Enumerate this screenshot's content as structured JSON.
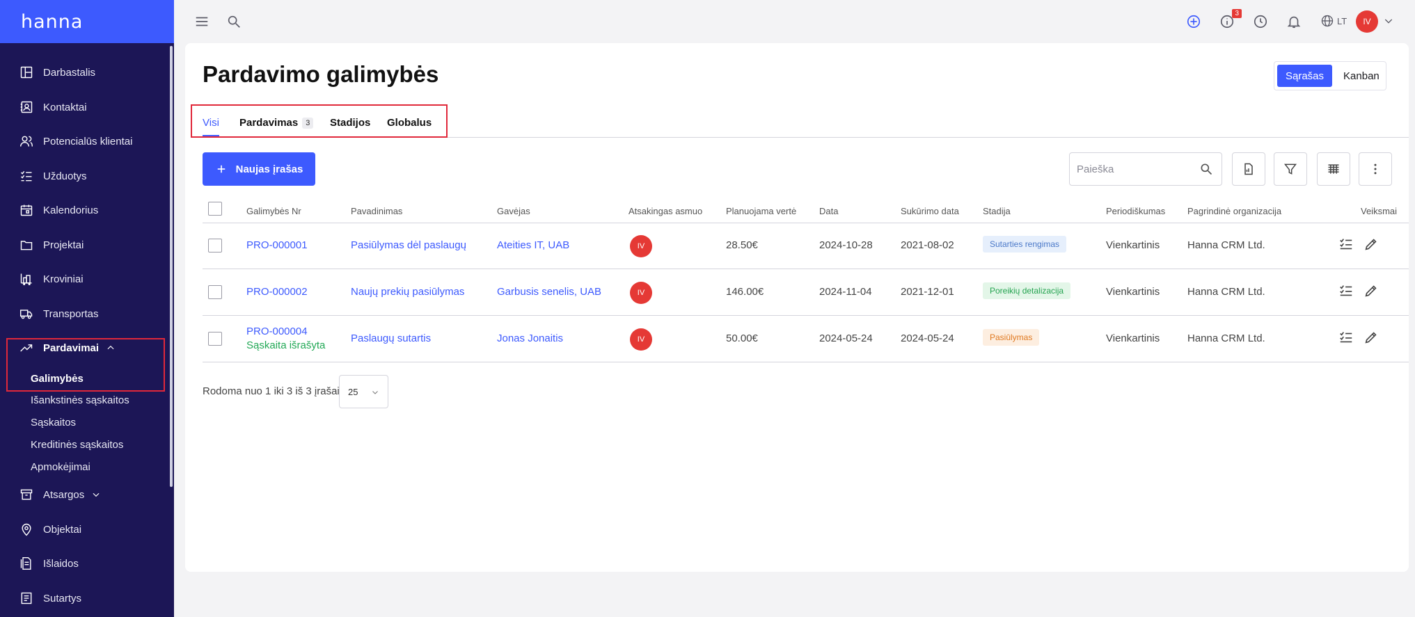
{
  "app": {
    "logo": "hanna"
  },
  "sidebar": {
    "items": [
      {
        "label": "Darbastalis",
        "icon": "dashboard-icon"
      },
      {
        "label": "Kontaktai",
        "icon": "contacts-icon"
      },
      {
        "label": "Potencialūs klientai",
        "icon": "leads-icon"
      },
      {
        "label": "Užduotys",
        "icon": "tasks-icon"
      },
      {
        "label": "Kalendorius",
        "icon": "calendar-icon"
      },
      {
        "label": "Projektai",
        "icon": "folder-icon"
      },
      {
        "label": "Kroviniai",
        "icon": "cargo-icon"
      },
      {
        "label": "Transportas",
        "icon": "truck-icon"
      },
      {
        "label": "Pardavimai",
        "icon": "trending-up-icon"
      },
      {
        "label": "Atsargos",
        "icon": "archive-icon"
      },
      {
        "label": "Objektai",
        "icon": "location-pin-icon"
      },
      {
        "label": "Išlaidos",
        "icon": "expenses-icon"
      },
      {
        "label": "Sutartys",
        "icon": "contract-icon"
      }
    ],
    "sales_sub": [
      "Galimybės",
      "Išankstinės sąskaitos",
      "Sąskaitos",
      "Kreditinės sąskaitos",
      "Apmokėjimai"
    ]
  },
  "topbar": {
    "notifications_count": "3",
    "language": "LT",
    "user_initials": "IV"
  },
  "main": {
    "title": "Pardavimo galimybės",
    "view_toggle": {
      "list": "Sąrašas",
      "kanban": "Kanban"
    },
    "tabs": [
      {
        "label": "Visi"
      },
      {
        "label": "Pardavimas",
        "count": "3"
      },
      {
        "label": "Stadijos"
      },
      {
        "label": "Globalus"
      }
    ],
    "new_button": "Naujas įrašas",
    "search_placeholder": "Paieška"
  },
  "table": {
    "columns": [
      "Galimybės Nr",
      "Pavadinimas",
      "Gavėjas",
      "Atsakingas asmuo",
      "Planuojama vertė",
      "Data",
      "Sukūrimo data",
      "Stadija",
      "Periodiškumas",
      "Pagrindinė organizacija",
      "Veiksmai"
    ],
    "rows": [
      {
        "nr": "PRO-000001",
        "note": "",
        "name": "Pasiūlymas dėl paslaugų",
        "recipient": "Ateities IT, UAB",
        "owner": "IV",
        "value": "28.50€",
        "date": "2024-10-28",
        "created": "2021-08-02",
        "stage": "Sutarties rengimas",
        "stage_bg": "#e6effc",
        "stage_fg": "#4a78c8",
        "period": "Vienkartinis",
        "org": "Hanna CRM Ltd."
      },
      {
        "nr": "PRO-000002",
        "note": "",
        "name": "Naujų prekių pasiūlymas",
        "recipient": "Garbusis senelis, UAB",
        "owner": "IV",
        "value": "146.00€",
        "date": "2024-11-04",
        "created": "2021-12-01",
        "stage": "Poreikių detalizacija",
        "stage_bg": "#e3f6e8",
        "stage_fg": "#24a350",
        "period": "Vienkartinis",
        "org": "Hanna CRM Ltd."
      },
      {
        "nr": "PRO-000004",
        "note": "Sąskaita išrašyta",
        "name": "Paslaugų sutartis",
        "recipient": "Jonas Jonaitis",
        "owner": "IV",
        "value": "50.00€",
        "date": "2024-05-24",
        "created": "2024-05-24",
        "stage": "Pasiūlymas",
        "stage_bg": "#fdeee0",
        "stage_fg": "#e07a22",
        "period": "Vienkartinis",
        "org": "Hanna CRM Ltd."
      }
    ]
  },
  "pager": {
    "text": "Rodoma nuo 1 iki 3 iš 3 įrašai",
    "page_size": "25"
  },
  "colors": {
    "accent": "#3d5afe",
    "sidebar": "#1c1656",
    "danger": "#e53935"
  }
}
